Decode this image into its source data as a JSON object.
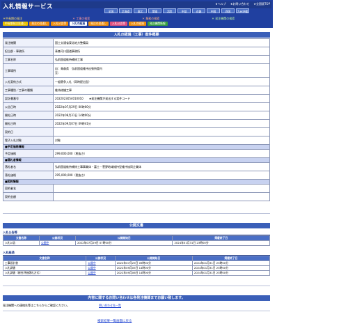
{
  "header": {
    "logo": "入札情報サービス",
    "links": [
      "★ヘルプ",
      "★お問い合わせ",
      "★全国版TOP"
    ],
    "regions": [
      "全国",
      "北海道",
      "東北",
      "関東",
      "北陸",
      "中部",
      "近畿",
      "中国",
      "四国",
      "九州沖縄"
    ],
    "categories": [
      "＊中長期の発注",
      "＊ 工事の検索",
      "＊ 業務の検索",
      "＊ 発注機関の検索"
    ],
    "tabs": [
      "中長期発注見通し",
      "発注の見通し",
      "入札公告等",
      "入札の経過",
      "発注の見通し",
      "入札公告等",
      "入札の経過",
      "発注機関情報"
    ]
  },
  "main": {
    "title": "入札の経過（工事）案件概要",
    "rows": [
      {
        "k": "発注機関",
        "v": "国土交通省東北地方整備局"
      },
      {
        "k": "担当部・事務所",
        "v": "青森河川国道事務所"
      },
      {
        "k": "工事名称",
        "v": "弘前国道維持補修工事"
      },
      {
        "k": "工事場所",
        "v": "自：青森県　弘前国道維持出張所管内\n至："
      },
      {
        "k": "入札契約方式",
        "v": "一般競争入札（同時提出型）"
      },
      {
        "k": "工事種別／工事の種類",
        "v": "維持修繕工事"
      },
      {
        "k": "設計書番号",
        "v": "2022023054010010　　★発注機関が発出する案件コード"
      },
      {
        "k": "公告日時",
        "v": "2022年07月29日 00時00分"
      },
      {
        "k": "開札日時",
        "v": "2022年08月31日 14時00分"
      },
      {
        "k": "開札日時",
        "v": "2022年09月07日 09時41分"
      },
      {
        "k": "契約日",
        "v": ""
      },
      {
        "k": "電子入札対象",
        "v": "対象"
      }
    ],
    "sec1": "■予定価格情報",
    "yotei_k": "予定価格",
    "yotei_v": "299,000,000（税抜き）",
    "sec2": "■落札者情報",
    "rakusatsu": [
      {
        "k": "落札者名",
        "v": "弘前国道維持補修工事事業体・富士・菅野地域維持型維持協同企業体"
      },
      {
        "k": "落札価格",
        "v": "295,000,000（税抜き）"
      }
    ],
    "sec3": "■契約情報",
    "keiyaku": [
      {
        "k": "契約者名",
        "v": ""
      },
      {
        "k": "契約金額",
        "v": ""
      }
    ]
  },
  "docs": {
    "title": "公開文書",
    "sub1": "入札公告等",
    "headers": [
      "文書名称",
      "公開状況",
      "公開開始日",
      "掲載終了日"
    ],
    "rows1": [
      [
        "入札公告",
        "公開中",
        "2022年07月29日 07時00分",
        "2024年01月31日 23時00分"
      ]
    ],
    "sub2": "入札経過",
    "rows2": [
      [
        "工事設計書",
        "公開中",
        "2022年07月29日 09時00分",
        "2024年01月31日 23時00分"
      ],
      [
        "入札調書",
        "公開中",
        "2022年09月05日 14時00分",
        "2024年01月31日 23時00分"
      ],
      [
        "入札調書（総合評価落札方式）",
        "公開中",
        "2022年09月06日 14時00分",
        "2024年01月31日 23時00分"
      ]
    ]
  },
  "contact": {
    "title": "内容に関するお問い合わせは各発注機関までお願い致します。",
    "text": "発注機関への連絡先等はこちらからご確認ください。",
    "link": "問い合わせ先一覧"
  },
  "back": "検索結果一覧画面に戻る"
}
